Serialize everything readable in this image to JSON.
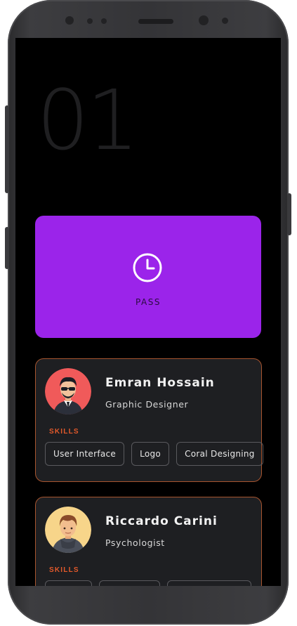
{
  "screen": {
    "number": "01",
    "pass_card": {
      "label": "PASS",
      "icon": "clock-icon",
      "color": "#9b24ea"
    }
  },
  "profiles": [
    {
      "name": "Emran Hossain",
      "role": "Graphic Designer",
      "skills_label": "SKILLS",
      "avatar": "man-sunglasses-avatar",
      "avatar_bg": "#f05a5a",
      "skills": [
        "User Interface",
        "Logo",
        "Coral Designing"
      ]
    },
    {
      "name": "Riccardo Carini",
      "role": "Psychologist",
      "skills_label": "SKILLS",
      "avatar": "man-hoodie-avatar",
      "avatar_bg": "#f7d58a",
      "skills": []
    }
  ],
  "colors": {
    "accent": "#e3592b",
    "card_border": "#a8552f",
    "card_bg": "#1e1f22"
  }
}
